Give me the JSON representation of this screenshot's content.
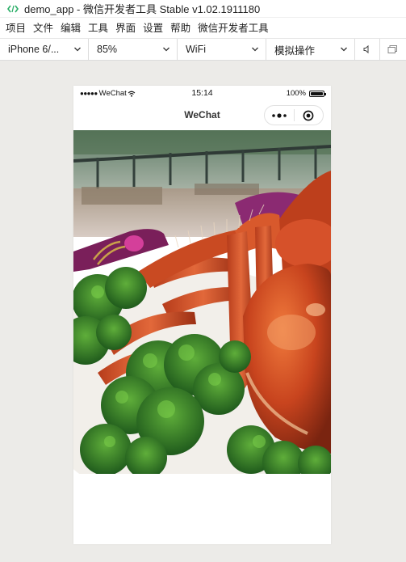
{
  "window": {
    "title": "demo_app - 微信开发者工具 Stable v1.02.1911180"
  },
  "menu": {
    "items": [
      "项目",
      "文件",
      "编辑",
      "工具",
      "界面",
      "设置",
      "帮助",
      "微信开发者工具"
    ]
  },
  "toolbar": {
    "device": "iPhone 6/...",
    "zoom": "85%",
    "network": "WiFi",
    "operation": "模拟操作"
  },
  "statusbar": {
    "carrier": "WeChat",
    "time": "15:14",
    "battery": "100%",
    "battery_level": 1.0
  },
  "navbar": {
    "title": "WeChat"
  },
  "colors": {
    "app_icon": "#2aae67",
    "sim_background": "#ecebe8",
    "window_background": "#ffffff"
  },
  "icons": {
    "app": "code-brackets-icon",
    "volume": "speaker-icon",
    "window": "window-icon",
    "more": "more-dots-icon",
    "close": "target-circle-icon",
    "wifi": "wifi-icon",
    "battery": "battery-icon"
  }
}
